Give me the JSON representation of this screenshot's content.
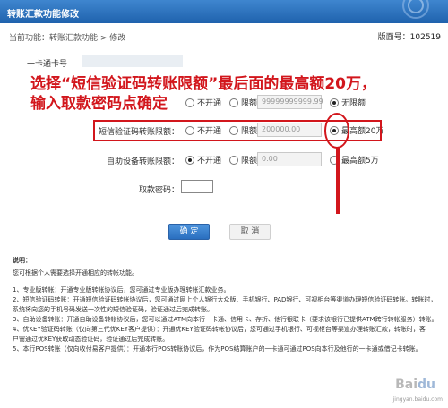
{
  "window": {
    "title": "转账汇款功能修改"
  },
  "breadcrumb": {
    "text": "当前功能：转账汇款功能 > 修改"
  },
  "version": {
    "label": "版面号：",
    "number": "102519"
  },
  "card": {
    "label": "一卡通卡号"
  },
  "annotation": {
    "line1": "选择“短信验证码转账限额”最后面的最高额20万，",
    "line2": "输入取款密码点确定"
  },
  "rows": [
    {
      "label": "",
      "options": [
        "不开通",
        "限额",
        "无限额"
      ],
      "selected": 2,
      "amount": "99999999999.99"
    },
    {
      "label": "短信验证码转账限额：",
      "options": [
        "不开通",
        "限额",
        "最高额20万"
      ],
      "selected": 2,
      "amount": "200000.00"
    },
    {
      "label": "自助设备转账限额：",
      "options": [
        "不开通",
        "限额",
        "最高额5万"
      ],
      "selected": 0,
      "amount": "0.00"
    }
  ],
  "password": {
    "label": "取款密码："
  },
  "buttons": {
    "ok": "确 定",
    "cancel": "取 消"
  },
  "notes": {
    "heading": "说明：",
    "intro": "您可根据个人需要选择开通相应的转帐功能。",
    "items": [
      "1、专业版转帐：开通专业版转帐协议后，您可通过专业版办理转帐汇款业务。",
      "2、短信验证码转账：开通短信验证码转帐协议后，您可通过网上个人银行大众版、手机银行、PAD银行、可视柜台等渠道办理短信验证码转账。转账时，",
      "系统将向您的手机号码发送一次性的短信验证码，验证通过后完成转账。",
      "3、自助设备转账：开通自助设备转帐协议后，您可以通过ATM向本行一卡通、信用卡、存折、他行银联卡（要求该银行已提供ATM跨行转帐服务）转账。",
      "4、优KEY验证码转账（仅向第三代优KEY客户提供）：开通优KEY验证码转帐协议后，您可通过手机银行、可视柜台等渠道办理转账汇款，转账时，客",
      "户需通过优KEY获取动态验证码，验证通过后完成转账。",
      "5、本行POS转账（仅向收付易客户提供）：开通本行POS转账协议后，作为POS结算账户的一卡通可通过POS向本行及他行的一卡通或借记卡转账。"
    ]
  },
  "watermark": {
    "text": "jingyan.baidu.com"
  },
  "colors": {
    "title_bar": "#2f74c0",
    "annotation": "#d2161c",
    "ok_button": "#3a7fcf"
  }
}
